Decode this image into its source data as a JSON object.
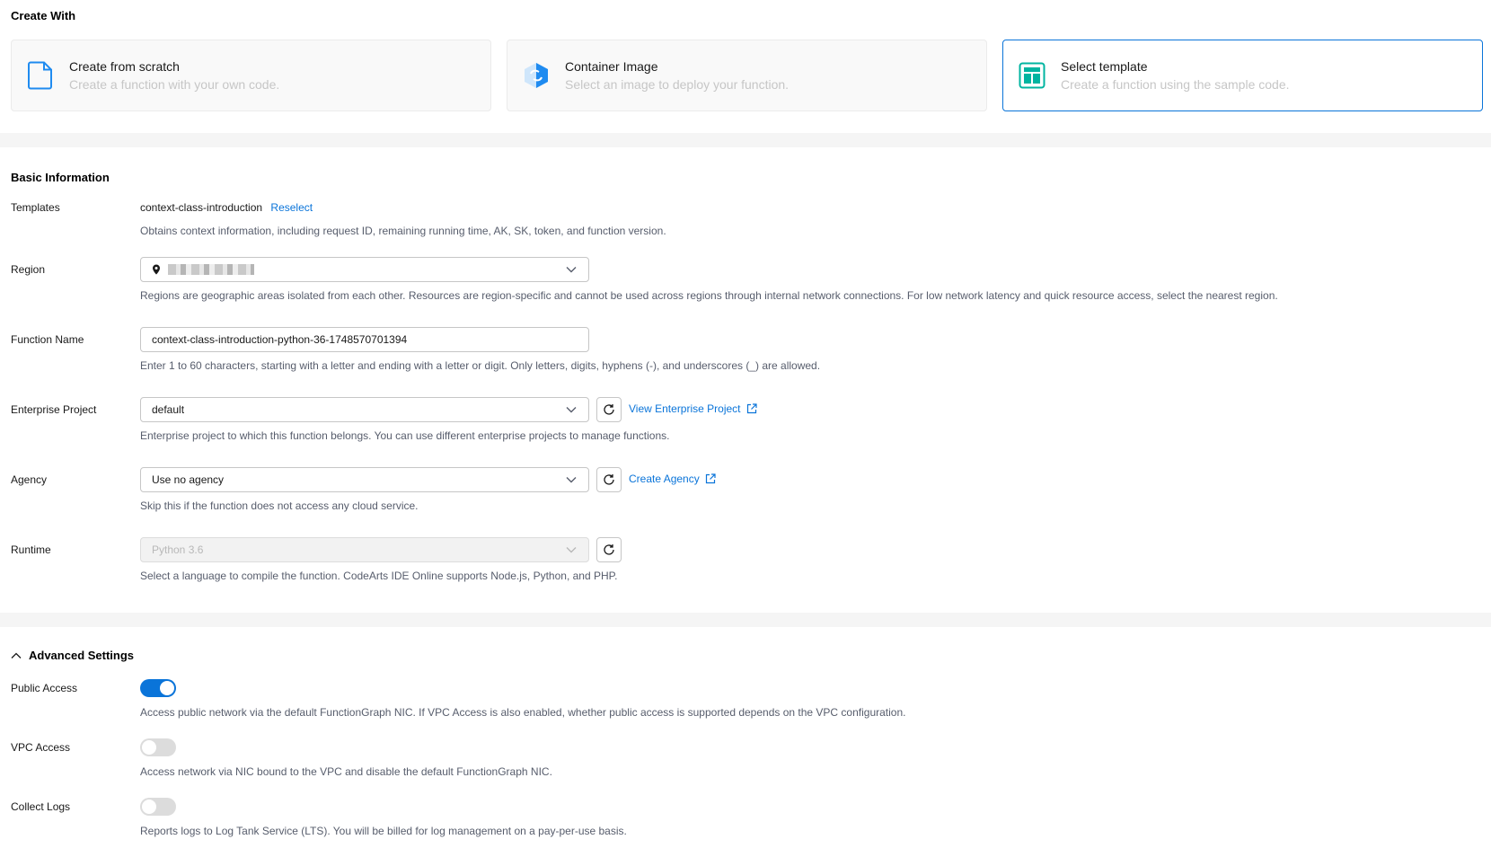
{
  "create_with": {
    "title": "Create With",
    "cards": [
      {
        "title": "Create from scratch",
        "desc": "Create a function with your own code.",
        "icon": "file-icon",
        "selected": false
      },
      {
        "title": "Container Image",
        "desc": "Select an image to deploy your function.",
        "icon": "container-icon",
        "selected": false
      },
      {
        "title": "Select template",
        "desc": "Create a function using the sample code.",
        "icon": "template-icon",
        "selected": true
      }
    ]
  },
  "basic": {
    "title": "Basic Information",
    "templates": {
      "label": "Templates",
      "value": "context-class-introduction",
      "reselect": "Reselect",
      "hint": "Obtains context information, including request ID, remaining running time, AK, SK, token, and function version."
    },
    "region": {
      "label": "Region",
      "hint": "Regions are geographic areas isolated from each other. Resources are region-specific and cannot be used across regions through internal network connections. For low network latency and quick resource access, select the nearest region."
    },
    "function_name": {
      "label": "Function Name",
      "value": "context-class-introduction-python-36-1748570701394",
      "hint": "Enter 1 to 60 characters, starting with a letter and ending with a letter or digit. Only letters, digits, hyphens (-), and underscores (_) are allowed."
    },
    "enterprise_project": {
      "label": "Enterprise Project",
      "value": "default",
      "link": "View Enterprise Project",
      "hint": "Enterprise project to which this function belongs. You can use different enterprise projects to manage functions."
    },
    "agency": {
      "label": "Agency",
      "value": "Use no agency",
      "link": "Create Agency",
      "hint": "Skip this if the function does not access any cloud service."
    },
    "runtime": {
      "label": "Runtime",
      "value": "Python 3.6",
      "hint": "Select a language to compile the function. CodeArts IDE Online supports Node.js, Python, and PHP."
    }
  },
  "advanced": {
    "title": "Advanced Settings",
    "public_access": {
      "label": "Public Access",
      "on": true,
      "hint": "Access public network via the default FunctionGraph NIC. If VPC Access is also enabled, whether public access is supported depends on the VPC configuration."
    },
    "vpc_access": {
      "label": "VPC Access",
      "on": false,
      "hint": "Access network via NIC bound to the VPC and disable the default FunctionGraph NIC."
    },
    "collect_logs": {
      "label": "Collect Logs",
      "on": false,
      "hint": "Reports logs to Log Tank Service (LTS). You will be billed for log management on a pay-per-use basis."
    }
  },
  "colors": {
    "primary": "#0a74d9",
    "teal": "#00b4a0",
    "page_gap": "#f5f5f5"
  }
}
